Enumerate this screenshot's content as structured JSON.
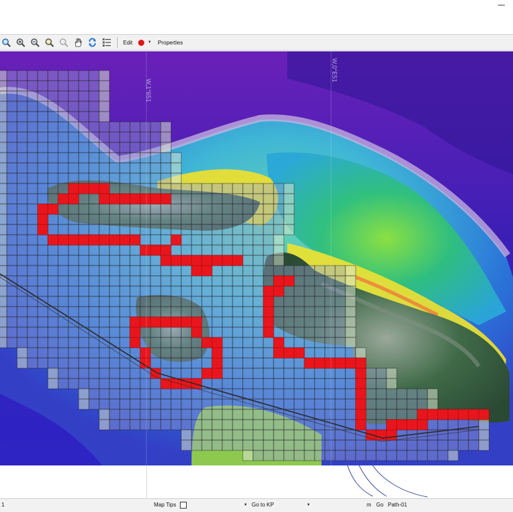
{
  "toolbar": {
    "edit_label": "Edit",
    "properties_label": "Properties",
    "edit_color": "#e3141b",
    "icons": [
      "zoom-full-icon",
      "zoom-in-icon",
      "zoom-out-icon",
      "zoom-selection-icon",
      "zoom-disabled-icon",
      "pan-hand-icon",
      "refresh-icon",
      "layer-list-icon"
    ]
  },
  "map": {
    "graticule_labels": [
      "W,1°651",
      "W,0°E51"
    ],
    "highlight_color": "#e8161c",
    "grid_color": "#1a1a1a",
    "route_color": "#2a2a2a"
  },
  "statusbar": {
    "left_text": "1",
    "map_tips_label": "Map Tips",
    "map_tips_checked": false,
    "go_to_kp_label": "Go to KP",
    "unit_label": "m",
    "go_label": "Go",
    "path_label": "Path-01"
  }
}
